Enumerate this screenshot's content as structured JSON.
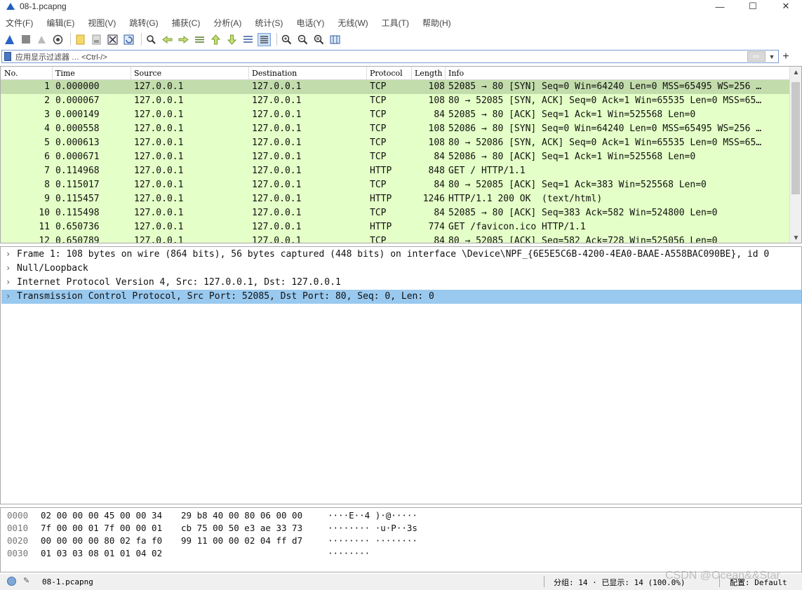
{
  "window": {
    "title": "08-1.pcapng",
    "min_symbol": "—",
    "max_symbol": "☐",
    "close_symbol": "✕"
  },
  "menu": [
    "文件(F)",
    "编辑(E)",
    "视图(V)",
    "跳转(G)",
    "捕获(C)",
    "分析(A)",
    "统计(S)",
    "电话(Y)",
    "无线(W)",
    "工具(T)",
    "帮助(H)"
  ],
  "toolbar_icons": [
    "shark-start-icon",
    "stop-icon",
    "restart-icon",
    "options-icon",
    "open-icon",
    "save-icon",
    "close-file-icon",
    "reload-icon",
    "find-icon",
    "back-icon",
    "forward-icon",
    "goto-icon",
    "first-icon",
    "last-icon",
    "autoscroll-icon",
    "colorize-icon",
    "zoom-in-icon",
    "zoom-out-icon",
    "zoom-normal-icon",
    "resize-columns-icon"
  ],
  "filter": {
    "placeholder": "应用显示过滤器 … <Ctrl-/>",
    "apply_symbol": "⇨",
    "dropdown_symbol": "▼",
    "plus": "+"
  },
  "packet_list": {
    "columns": [
      "No.",
      "Time",
      "Source",
      "Destination",
      "Protocol",
      "Length",
      "Info"
    ],
    "rows": [
      {
        "no": "1",
        "time": "0.000000",
        "src": "127.0.0.1",
        "dst": "127.0.0.1",
        "proto": "TCP",
        "len": "108",
        "info": "52085 → 80 [SYN] Seq=0 Win=64240 Len=0 MSS=65495 WS=256 …"
      },
      {
        "no": "2",
        "time": "0.000067",
        "src": "127.0.0.1",
        "dst": "127.0.0.1",
        "proto": "TCP",
        "len": "108",
        "info": "80 → 52085 [SYN, ACK] Seq=0 Ack=1 Win=65535 Len=0 MSS=65…"
      },
      {
        "no": "3",
        "time": "0.000149",
        "src": "127.0.0.1",
        "dst": "127.0.0.1",
        "proto": "TCP",
        "len": "84",
        "info": "52085 → 80 [ACK] Seq=1 Ack=1 Win=525568 Len=0"
      },
      {
        "no": "4",
        "time": "0.000558",
        "src": "127.0.0.1",
        "dst": "127.0.0.1",
        "proto": "TCP",
        "len": "108",
        "info": "52086 → 80 [SYN] Seq=0 Win=64240 Len=0 MSS=65495 WS=256 …"
      },
      {
        "no": "5",
        "time": "0.000613",
        "src": "127.0.0.1",
        "dst": "127.0.0.1",
        "proto": "TCP",
        "len": "108",
        "info": "80 → 52086 [SYN, ACK] Seq=0 Ack=1 Win=65535 Len=0 MSS=65…"
      },
      {
        "no": "6",
        "time": "0.000671",
        "src": "127.0.0.1",
        "dst": "127.0.0.1",
        "proto": "TCP",
        "len": "84",
        "info": "52086 → 80 [ACK] Seq=1 Ack=1 Win=525568 Len=0"
      },
      {
        "no": "7",
        "time": "0.114968",
        "src": "127.0.0.1",
        "dst": "127.0.0.1",
        "proto": "HTTP",
        "len": "848",
        "info": "GET / HTTP/1.1"
      },
      {
        "no": "8",
        "time": "0.115017",
        "src": "127.0.0.1",
        "dst": "127.0.0.1",
        "proto": "TCP",
        "len": "84",
        "info": "80 → 52085 [ACK] Seq=1 Ack=383 Win=525568 Len=0"
      },
      {
        "no": "9",
        "time": "0.115457",
        "src": "127.0.0.1",
        "dst": "127.0.0.1",
        "proto": "HTTP",
        "len": "1246",
        "info": "HTTP/1.1 200 OK  (text/html)"
      },
      {
        "no": "10",
        "time": "0.115498",
        "src": "127.0.0.1",
        "dst": "127.0.0.1",
        "proto": "TCP",
        "len": "84",
        "info": "52085 → 80 [ACK] Seq=383 Ack=582 Win=524800 Len=0"
      },
      {
        "no": "11",
        "time": "0.650736",
        "src": "127.0.0.1",
        "dst": "127.0.0.1",
        "proto": "HTTP",
        "len": "774",
        "info": "GET /favicon.ico HTTP/1.1"
      },
      {
        "no": "12",
        "time": "0.650789",
        "src": "127.0.0.1",
        "dst": "127.0.0.1",
        "proto": "TCP",
        "len": "84",
        "info": "80 → 52085 [ACK] Seq=582 Ack=728 Win=525056 Len=0"
      }
    ],
    "row_color": "#e4ffc7",
    "selected_row_color": "#c3dcac"
  },
  "details": {
    "expand_symbol": "›",
    "rows": [
      "Frame 1: 108 bytes on wire (864 bits), 56 bytes captured (448 bits) on interface \\Device\\NPF_{6E5E5C6B-4200-4EA0-BAAE-A558BAC090BE}, id 0",
      "Null/Loopback",
      "Internet Protocol Version 4, Src: 127.0.0.1, Dst: 127.0.0.1",
      "Transmission Control Protocol, Src Port: 52085, Dst Port: 80, Seq: 0, Len: 0"
    ],
    "selected_index": 3,
    "selected_color": "#99c9ef"
  },
  "hex": {
    "rows": [
      {
        "offset": "0000",
        "b1": "02 00 00 00 45 00 00 34",
        "b2": "29 b8 40 00 80 06 00 00",
        "ascii": "····E··4 )·@·····"
      },
      {
        "offset": "0010",
        "b1": "7f 00 00 01 7f 00 00 01",
        "b2": "cb 75 00 50 e3 ae 33 73",
        "ascii": "········ ·u·P··3s"
      },
      {
        "offset": "0020",
        "b1": "00 00 00 00 80 02 fa f0",
        "b2": "99 11 00 00 02 04 ff d7",
        "ascii": "········ ········"
      },
      {
        "offset": "0030",
        "b1": "01 03 03 08 01 01 04 02",
        "b2": "",
        "ascii": "········"
      }
    ]
  },
  "status": {
    "file": "08-1.pcapng",
    "stats": "分组: 14 · 已显示: 14 (100.0%)",
    "profile": "配置: Default"
  },
  "watermark": "CSDN @Ocean&&Star"
}
